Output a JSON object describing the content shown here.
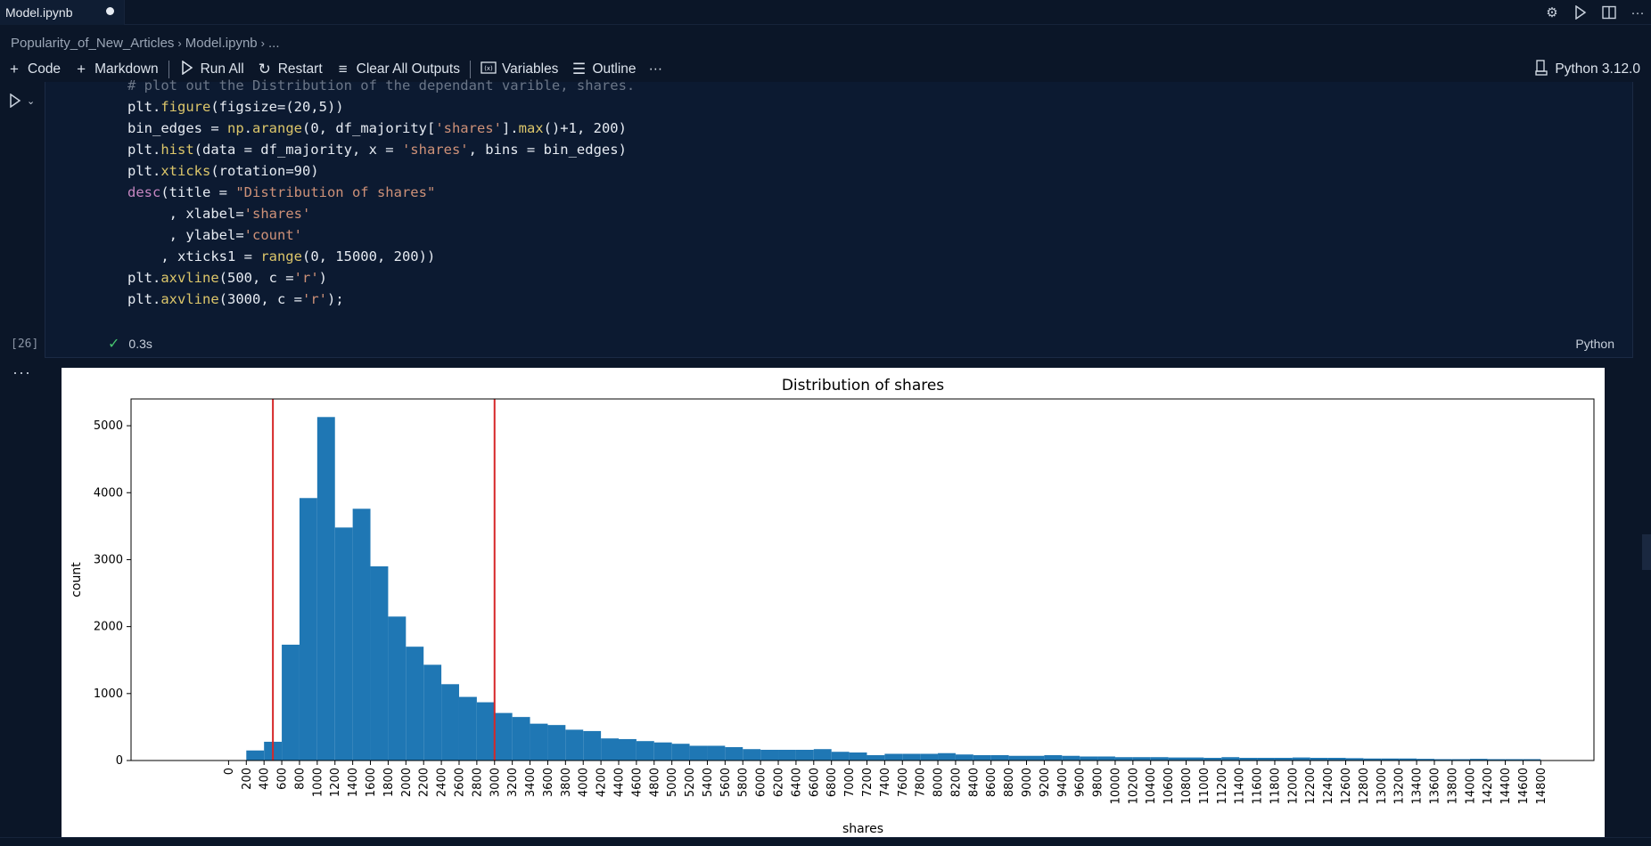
{
  "tab": {
    "title": "Model.ipynb"
  },
  "breadcrumb": {
    "folder": "Popularity_of_New_Articles",
    "file": "Model.ipynb",
    "more": "..."
  },
  "toolbar": {
    "code_label": "Code",
    "markdown_label": "Markdown",
    "run_all_label": "Run All",
    "restart_label": "Restart",
    "clear_outputs_label": "Clear All Outputs",
    "variables_label": "Variables",
    "outline_label": "Outline",
    "more_label": "···"
  },
  "kernel": {
    "label": "Python 3.12.0"
  },
  "cell": {
    "execution_count": "[26]",
    "duration": "0.3s",
    "language": "Python",
    "code_lines": [
      "# plot out the Distribution of the dependant varible, shares.",
      "plt.figure(figsize=(20,5))",
      "bin_edges = np.arange(0, df_majority['shares'].max()+1, 200)",
      "plt.hist(data = df_majority, x = 'shares', bins = bin_edges)",
      "plt.xticks(rotation=90)",
      "desc(title = \"Distribution of shares\"",
      "     , xlabel='shares'",
      "     , ylabel='count'",
      "    , xticks1 = range(0, 15000, 200))",
      "plt.axvline(500, c ='r')",
      "plt.axvline(3000, c ='r');"
    ]
  },
  "colors": {
    "bar": "#1f77b4",
    "axvline": "#d62728"
  },
  "chart_data": {
    "type": "bar",
    "title": "Distribution of shares",
    "xlabel": "shares",
    "ylabel": "count",
    "bin_width": 200,
    "bin_starts": [
      0,
      200,
      400,
      600,
      800,
      1000,
      1200,
      1400,
      1600,
      1800,
      2000,
      2200,
      2400,
      2600,
      2800,
      3000,
      3200,
      3400,
      3600,
      3800,
      4000,
      4200,
      4400,
      4600,
      4800,
      5000,
      5200,
      5400,
      5600,
      5800,
      6000,
      6200,
      6400,
      6600,
      6800,
      7000,
      7200,
      7400,
      7600,
      7800,
      8000,
      8200,
      8400,
      8600,
      8800,
      9000,
      9200,
      9400,
      9600,
      9800,
      10000,
      10200,
      10400,
      10600,
      10800,
      11000,
      11200,
      11400,
      11600,
      11800,
      12000,
      12200,
      12400,
      12600,
      12800,
      13000,
      13200,
      13400,
      13600,
      13800,
      14000,
      14200,
      14400,
      14600
    ],
    "values": [
      0,
      150,
      280,
      1730,
      3920,
      5130,
      3480,
      3760,
      2900,
      2150,
      1700,
      1430,
      1140,
      950,
      870,
      710,
      650,
      550,
      530,
      460,
      440,
      330,
      320,
      290,
      270,
      250,
      220,
      220,
      200,
      170,
      160,
      160,
      160,
      170,
      130,
      120,
      80,
      100,
      100,
      100,
      110,
      90,
      80,
      80,
      70,
      70,
      80,
      70,
      60,
      60,
      50,
      50,
      50,
      45,
      45,
      40,
      50,
      40,
      40,
      40,
      45,
      40,
      40,
      35,
      30,
      30,
      30,
      25,
      20,
      20,
      25,
      20,
      20,
      20,
      30
    ],
    "xticks": [
      0,
      200,
      400,
      600,
      800,
      1000,
      1200,
      1400,
      1600,
      1800,
      2000,
      2200,
      2400,
      2600,
      2800,
      3000,
      3200,
      3400,
      3600,
      3800,
      4000,
      4200,
      4400,
      4600,
      4800,
      5000,
      5200,
      5400,
      5600,
      5800,
      6000,
      6200,
      6400,
      6600,
      6800,
      7000,
      7200,
      7400,
      7600,
      7800,
      8000,
      8200,
      8400,
      8600,
      8800,
      9000,
      9200,
      9400,
      9600,
      9800,
      10000,
      10200,
      10400,
      10600,
      10800,
      11000,
      11200,
      11400,
      11600,
      11800,
      12000,
      12200,
      12400,
      12600,
      12800,
      13000,
      13200,
      13400,
      13600,
      13800,
      14000,
      14200,
      14400,
      14600,
      14800
    ],
    "yticks": [
      0,
      1000,
      2000,
      3000,
      4000,
      5000
    ],
    "xlim": [
      -1100,
      15400
    ],
    "ylim": [
      0,
      5400
    ],
    "vlines": [
      500,
      3000
    ],
    "grid": false,
    "legend": "none"
  }
}
